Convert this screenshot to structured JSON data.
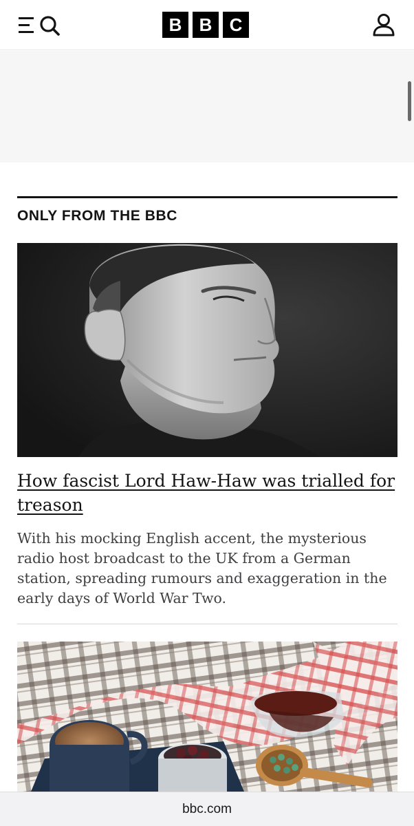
{
  "header": {
    "logo_letters": [
      "B",
      "B",
      "C"
    ],
    "menu_icon": "menu-icon",
    "search_icon": "search-icon",
    "account_icon": "user-icon"
  },
  "section": {
    "title": "ONLY FROM THE BBC"
  },
  "article": {
    "headline": "How fascist Lord Haw-Haw was trialled for treason",
    "summary": "With his mocking English accent, the mysterious radio host broadcast to the UK from a German station, spreading rumours and exaggeration in the early days of World War Two."
  },
  "browser": {
    "url": "bbc.com"
  },
  "colors": {
    "text": "#141414",
    "summary_text": "#3f3f42",
    "ad_background": "#f6f6f6"
  }
}
